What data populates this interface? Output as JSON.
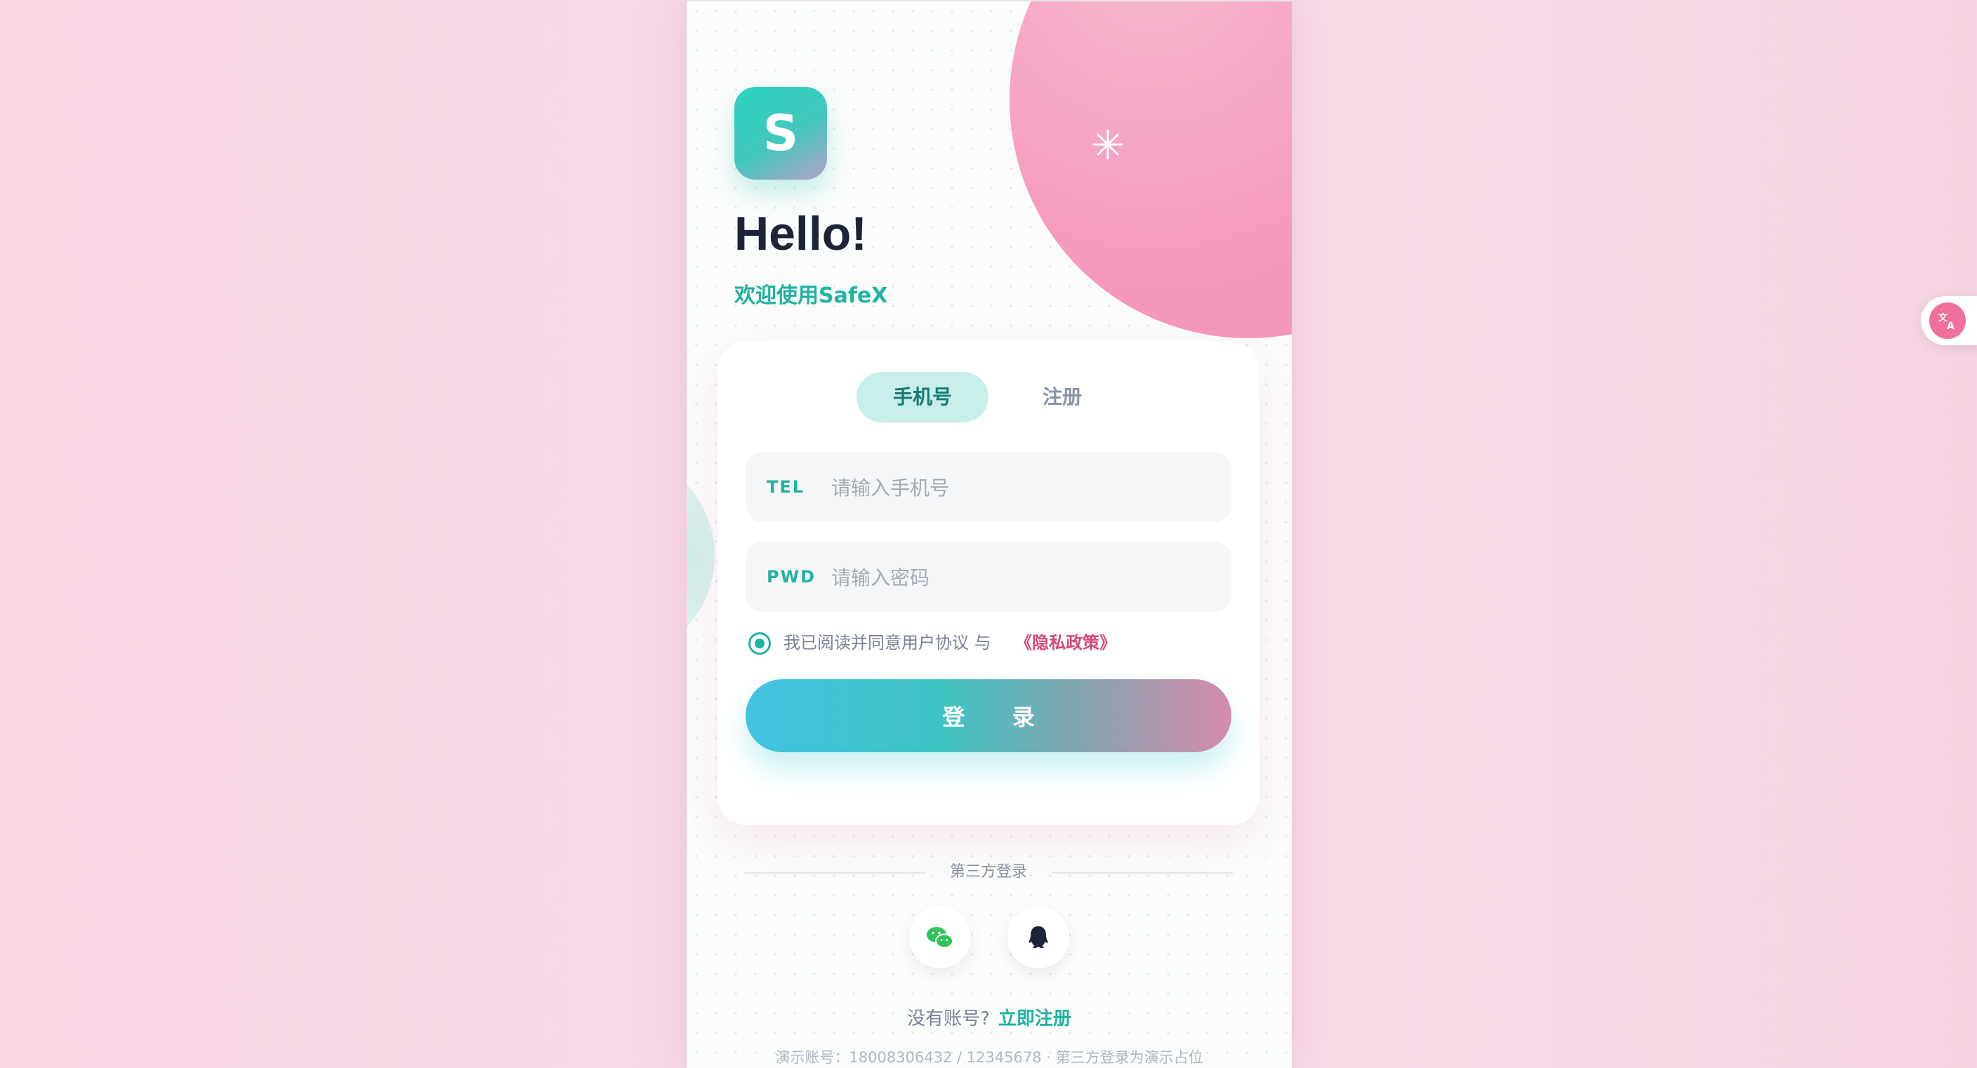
{
  "app": {
    "logo_letter": "S",
    "greeting": "Hello!",
    "welcome": "欢迎使用SafeX"
  },
  "tabs": [
    {
      "label": "手机号",
      "active": true
    },
    {
      "label": "注册",
      "active": false
    }
  ],
  "form": {
    "phone": {
      "label": "TEL",
      "placeholder": "请输入手机号",
      "value": ""
    },
    "password": {
      "label": "PWD",
      "placeholder": "请输入密码",
      "value": ""
    },
    "agreement": {
      "text": "我已阅读并同意用户协议 与",
      "link": "《隐私政策》",
      "checked": true
    },
    "login_label": "登 录"
  },
  "third_party": {
    "title": "第三方登录",
    "providers": [
      {
        "icon": "wechat-icon",
        "color": "#2ec55a"
      },
      {
        "icon": "qq-icon",
        "color": "#1c2435"
      }
    ]
  },
  "signup": {
    "question": "没有账号?",
    "action": "立即注册"
  },
  "demo_note": "演示账号：18008306432 / 12345678 · 第三方登录为演示占位",
  "colors": {
    "accent": "#1fb3a0",
    "link": "#d2497a",
    "blob": "#f59cbf"
  },
  "translate_widget": {
    "icon": "translate-icon"
  }
}
